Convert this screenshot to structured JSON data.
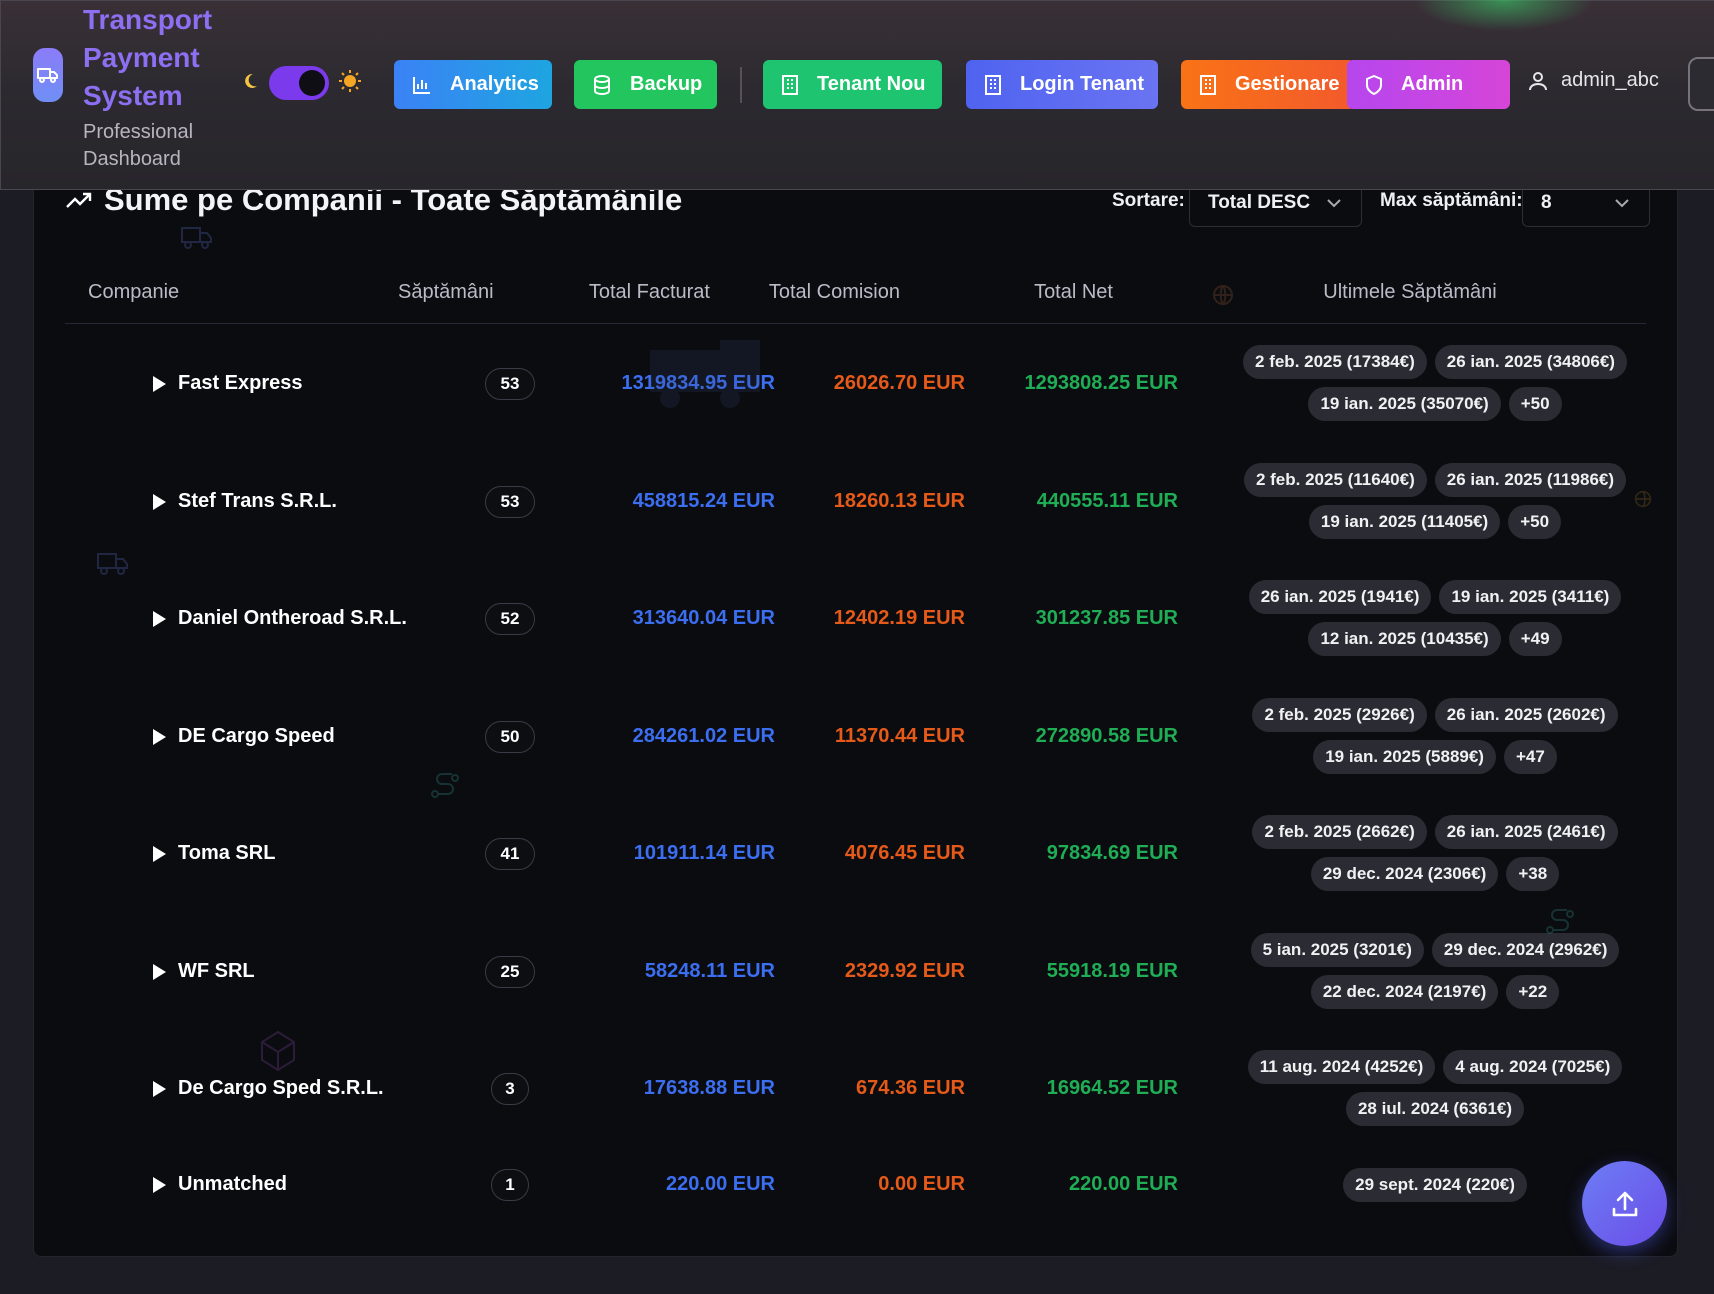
{
  "brand": {
    "title_lines": [
      "Transport",
      "Payment",
      "System"
    ],
    "subtitle_lines": [
      "Professional",
      "Dashboard"
    ]
  },
  "theme_toggle": {
    "left_icon": "moon-icon",
    "right_icon": "sun-icon",
    "state": "dark"
  },
  "nav": {
    "analytics": "Analytics",
    "backup": "Backup",
    "tenant_nou": "Tenant Nou",
    "login_tenant": "Login Tenant",
    "gestionare": "Gestionare",
    "admin": "Admin"
  },
  "user": {
    "name": "admin_abc"
  },
  "colors": {
    "analytics": "#2f8cf0",
    "backup": "#22c55e",
    "tenant_nou": "#1ec46f",
    "login_tenant": "#5b6cf0",
    "gestionare": "#f97316",
    "admin": "#c044e8",
    "facturat": "#3b6ef0",
    "comision": "#e55a18",
    "net": "#1fae55"
  },
  "section": {
    "title": "Sume pe Companii - Toate Săptămânile",
    "sort_label": "Sortare:",
    "sort_value": "Total DESC",
    "max_label": "Max săptămâni:",
    "max_value": "8"
  },
  "table": {
    "headers": {
      "company": "Companie",
      "weeks": "Săptămâni",
      "facturat": "Total Facturat",
      "comision": "Total Comision",
      "net": "Total Net",
      "last_weeks": "Ultimele Săptămâni"
    },
    "rows": [
      {
        "company": "Fast Express",
        "weeks": "53",
        "facturat": "1319834.95 EUR",
        "comision": "26026.70 EUR",
        "net": "1293808.25 EUR",
        "chips": [
          "2 feb. 2025 (17384€)",
          "26 ian. 2025 (34806€)",
          "19 ian. 2025 (35070€)",
          "+50"
        ]
      },
      {
        "company": "Stef Trans S.R.L.",
        "weeks": "53",
        "facturat": "458815.24 EUR",
        "comision": "18260.13 EUR",
        "net": "440555.11 EUR",
        "chips": [
          "2 feb. 2025 (11640€)",
          "26 ian. 2025 (11986€)",
          "19 ian. 2025 (11405€)",
          "+50"
        ]
      },
      {
        "company": "Daniel Ontheroad S.R.L.",
        "weeks": "52",
        "facturat": "313640.04 EUR",
        "comision": "12402.19 EUR",
        "net": "301237.85 EUR",
        "chips": [
          "26 ian. 2025 (1941€)",
          "19 ian. 2025 (3411€)",
          "12 ian. 2025 (10435€)",
          "+49"
        ]
      },
      {
        "company": "DE Cargo Speed",
        "weeks": "50",
        "facturat": "284261.02 EUR",
        "comision": "11370.44 EUR",
        "net": "272890.58 EUR",
        "chips": [
          "2 feb. 2025 (2926€)",
          "26 ian. 2025 (2602€)",
          "19 ian. 2025 (5889€)",
          "+47"
        ]
      },
      {
        "company": "Toma SRL",
        "weeks": "41",
        "facturat": "101911.14 EUR",
        "comision": "4076.45 EUR",
        "net": "97834.69 EUR",
        "chips": [
          "2 feb. 2025 (2662€)",
          "26 ian. 2025 (2461€)",
          "29 dec. 2024 (2306€)",
          "+38"
        ]
      },
      {
        "company": "WF SRL",
        "weeks": "25",
        "facturat": "58248.11 EUR",
        "comision": "2329.92 EUR",
        "net": "55918.19 EUR",
        "chips": [
          "5 ian. 2025 (3201€)",
          "29 dec. 2024 (2962€)",
          "22 dec. 2024 (2197€)",
          "+22"
        ]
      },
      {
        "company": "De Cargo Sped S.R.L.",
        "weeks": "3",
        "facturat": "17638.88 EUR",
        "comision": "674.36 EUR",
        "net": "16964.52 EUR",
        "chips": [
          "11 aug. 2024 (4252€)",
          "4 aug. 2024 (7025€)",
          "28 iul. 2024 (6361€)"
        ]
      },
      {
        "company": "Unmatched",
        "weeks": "1",
        "facturat": "220.00 EUR",
        "comision": "0.00 EUR",
        "net": "220.00 EUR",
        "chips": [
          "29 sept. 2024 (220€)"
        ]
      }
    ]
  }
}
